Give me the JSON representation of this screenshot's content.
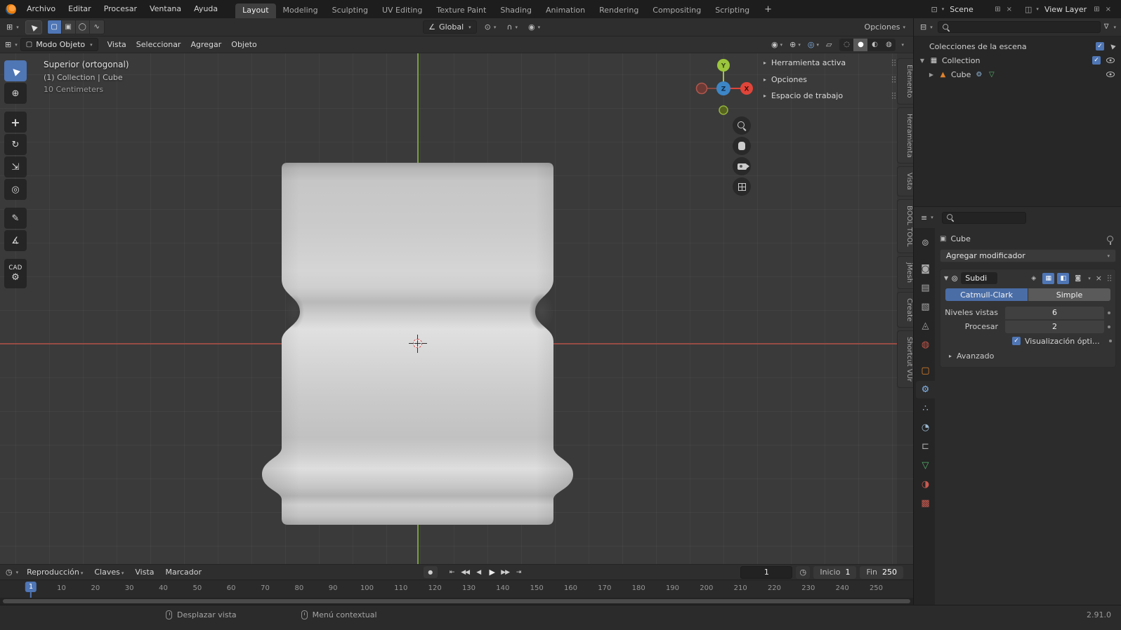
{
  "colors": {
    "accent": "#4772b3",
    "axis_x": "#a8524a",
    "axis_y": "#84b33c",
    "object_orange": "#e0822c"
  },
  "topbar": {
    "menus": [
      "Archivo",
      "Editar",
      "Procesar",
      "Ventana",
      "Ayuda"
    ],
    "workspaces": [
      "Layout",
      "Modeling",
      "Sculpting",
      "UV Editing",
      "Texture Paint",
      "Shading",
      "Animation",
      "Rendering",
      "Compositing",
      "Scripting"
    ],
    "active_workspace": "Layout",
    "new_workspace_label": "+",
    "scene": {
      "label": "Scene"
    },
    "view_layer": {
      "label": "View Layer"
    }
  },
  "tool_settings": {
    "orientation": "Global",
    "options_label": "Opciones"
  },
  "viewport": {
    "header": {
      "mode": "Modo Objeto",
      "menus": [
        "Vista",
        "Seleccionar",
        "Agregar",
        "Objeto"
      ]
    },
    "overlay": {
      "view": "Superior (ortogonal)",
      "context": "(1) Collection | Cube",
      "scale": "10 Centimeters"
    },
    "tools": [
      "select-box",
      "cursor",
      "move",
      "rotate",
      "scale",
      "transform",
      "annotate",
      "measure",
      "cad"
    ],
    "cad_tool_label": "CAD",
    "axis_labels": {
      "x": "X",
      "y": "Y",
      "z": "Z"
    },
    "npanel_sections": [
      "Herramienta activa",
      "Opciones",
      "Espacio de trabajo"
    ],
    "side_tabs": [
      "Elemento",
      "Herramienta",
      "Vista",
      "BOOL TOOL",
      "jMesh",
      "Create",
      "Shortcut VUr"
    ]
  },
  "outliner": {
    "rows": {
      "scene_collection": "Colecciones de la escena",
      "collection": "Collection",
      "object": "Cube"
    }
  },
  "properties": {
    "tabs": [
      "tool",
      "render",
      "output",
      "view-layer",
      "scene",
      "world",
      "object",
      "modifiers",
      "particles",
      "physics",
      "constraints",
      "object-data",
      "material",
      "texture"
    ],
    "active_tab": "modifiers",
    "breadcrumb": "Cube",
    "add_modifier_label": "Agregar modificador",
    "modifier": {
      "name": "Subdi",
      "types": [
        "Catmull-Clark",
        "Simple"
      ],
      "active_type": "Catmull-Clark",
      "fields": [
        {
          "label": "Niveles vistas",
          "value": "6"
        },
        {
          "label": "Procesar",
          "value": "2"
        }
      ],
      "optimal_display_label": "Visualización ópti…",
      "advanced_label": "Avanzado"
    }
  },
  "timeline": {
    "menus": [
      {
        "label": "Reproducción",
        "caret": true
      },
      {
        "label": "Claves",
        "caret": true
      },
      {
        "label": "Vista",
        "caret": false
      },
      {
        "label": "Marcador",
        "caret": false
      }
    ],
    "transport": [
      "jump-to-start",
      "prev-keyframe",
      "play-reverse",
      "play",
      "next-keyframe",
      "jump-to-end"
    ],
    "current_frame": "1",
    "start": {
      "label": "Inicio",
      "value": "1"
    },
    "end": {
      "label": "Fin",
      "value": "250"
    },
    "ruler_ticks": [
      10,
      20,
      30,
      40,
      50,
      60,
      70,
      80,
      90,
      100,
      110,
      120,
      130,
      140,
      150,
      160,
      170,
      180,
      190,
      200,
      210,
      220,
      230,
      240,
      250
    ],
    "marker_frame": "1"
  },
  "statusbar": {
    "hints": [
      "Desplazar vista",
      "Menú contextual"
    ],
    "version": "2.91.0"
  }
}
